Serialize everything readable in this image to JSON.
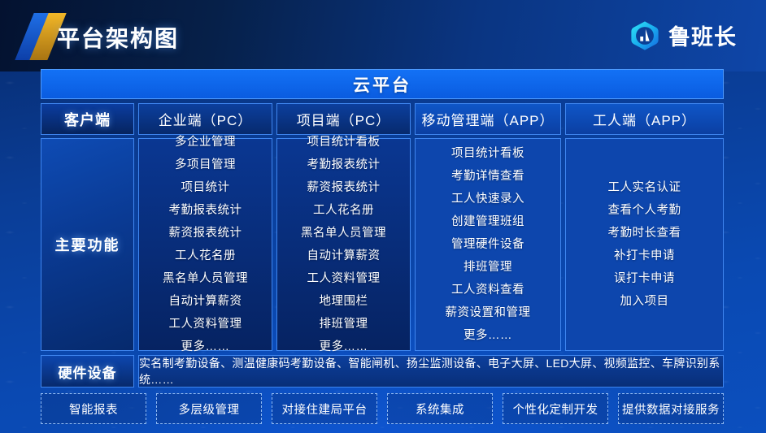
{
  "header": {
    "title": "平台架构图",
    "brand_name": "鲁班长",
    "logo_icon": "luban-hexagon-logo-icon",
    "mark_icon": "slanted-bars-icon"
  },
  "cloud_bar": {
    "label": "云平台"
  },
  "rows": {
    "client_label": "客户端",
    "features_label": "主要功能",
    "hardware_label": "硬件设备"
  },
  "columns": [
    {
      "header": "企业端（PC）",
      "type": "pc",
      "features": [
        "多企业管理",
        "多项目管理",
        "项目统计",
        "考勤报表统计",
        "薪资报表统计",
        "工人花名册",
        "黑名单人员管理",
        "自动计算薪资",
        "工人资料管理",
        "更多……"
      ]
    },
    {
      "header": "项目端（PC）",
      "type": "pc",
      "features": [
        "项目统计看板",
        "考勤报表统计",
        "薪资报表统计",
        "工人花名册",
        "黑名单人员管理",
        "自动计算薪资",
        "工人资料管理",
        "地理围栏",
        "排班管理",
        "更多……"
      ]
    },
    {
      "header": "移动管理端（APP）",
      "type": "app",
      "features": [
        "项目统计看板",
        "考勤详情查看",
        "工人快速录入",
        "创建管理班组",
        "管理硬件设备",
        "排班管理",
        "工人资料查看",
        "薪资设置和管理",
        "更多……"
      ]
    },
    {
      "header": "工人端（APP）",
      "type": "app",
      "features": [
        "工人实名认证",
        "查看个人考勤",
        "考勤时长查看",
        "补打卡申请",
        "误打卡申请",
        "加入项目"
      ]
    }
  ],
  "hardware": {
    "list": "实名制考勤设备、测温健康码考勤设备、智能闸机、扬尘监测设备、电子大屏、LED大屏、视频监控、车牌识别系统……"
  },
  "tags": [
    "智能报表",
    "多层级管理",
    "对接住建局平台",
    "系统集成",
    "个性化定制开发",
    "提供数据对接服务"
  ],
  "colors": {
    "accent_blue": "#1371f5",
    "border_blue": "#3f86f0",
    "app_panel": "#0d46ad",
    "pc_panel": "#0a3792",
    "logo_cyan": "#25d7f0",
    "logo_gold": "#f2b728"
  }
}
